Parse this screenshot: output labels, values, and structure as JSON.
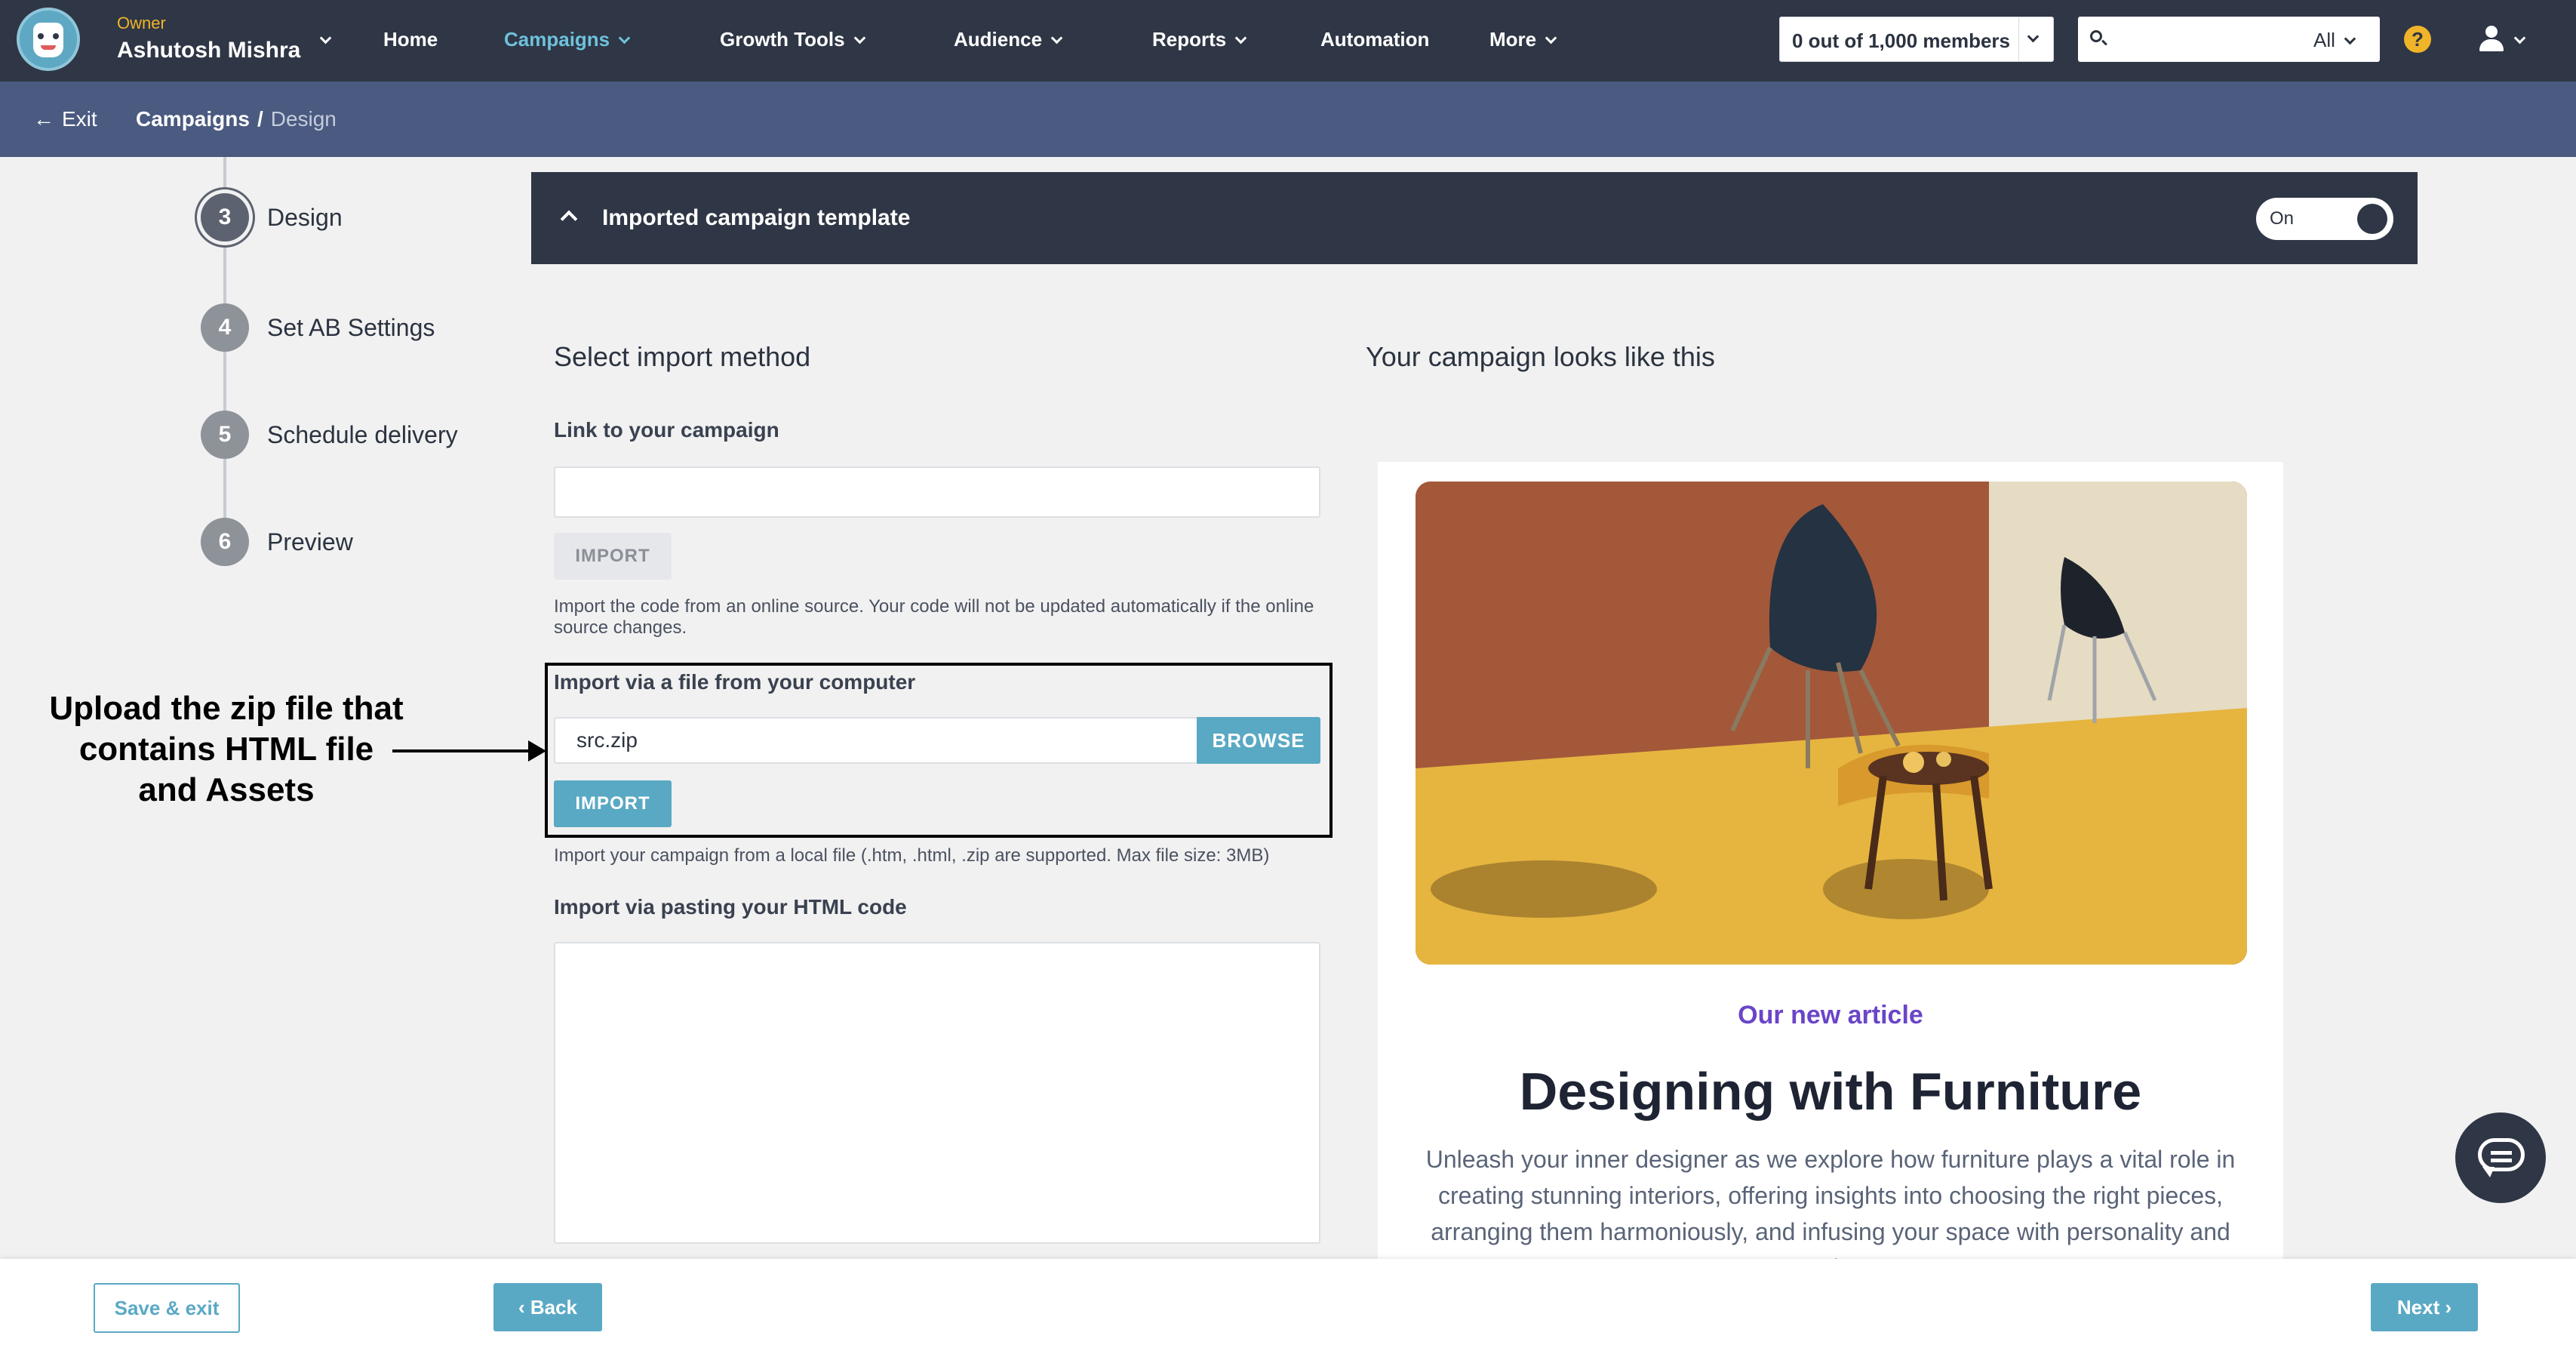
{
  "topnav": {
    "owner_role": "Owner",
    "owner_name": "Ashutosh Mishra",
    "items": [
      {
        "label": "Home",
        "active": false,
        "dropdown": false
      },
      {
        "label": "Campaigns",
        "active": true,
        "dropdown": true
      },
      {
        "label": "Growth Tools",
        "active": false,
        "dropdown": true
      },
      {
        "label": "Audience",
        "active": false,
        "dropdown": true
      },
      {
        "label": "Reports",
        "active": false,
        "dropdown": true
      },
      {
        "label": "Automation",
        "active": false,
        "dropdown": false
      },
      {
        "label": "More",
        "active": false,
        "dropdown": true
      }
    ],
    "members_label": "0 out of 1,000 members",
    "search_placeholder": "",
    "search_scope": "All",
    "help_label": "?",
    "icons": {
      "search": "search-icon",
      "help": "help-icon",
      "user": "user-icon"
    },
    "accent_color": "#6ec1dc"
  },
  "subnav": {
    "exit_label": "Exit",
    "breadcrumb": [
      "Campaigns",
      "Design"
    ],
    "separator": "/"
  },
  "steps": [
    {
      "number": "3",
      "label": "Design",
      "current": true
    },
    {
      "number": "4",
      "label": "Set AB Settings",
      "current": false
    },
    {
      "number": "5",
      "label": "Schedule delivery",
      "current": false
    },
    {
      "number": "6",
      "label": "Preview",
      "current": false
    }
  ],
  "annotation": {
    "text_lines": [
      "Upload the zip file that",
      "contains HTML file",
      "and Assets"
    ]
  },
  "template_bar": {
    "title": "Imported campaign template",
    "toggle_label": "On",
    "toggle_on": true
  },
  "import": {
    "section_title": "Select import method",
    "link": {
      "label": "Link to your campaign",
      "value": "",
      "button": "IMPORT",
      "help": "Import the code from an online source. Your code will not be updated automatically if the online source changes."
    },
    "file": {
      "label": "Import via a file from your computer",
      "value": "src.zip",
      "browse_button": "BROWSE",
      "button": "IMPORT",
      "help": "Import your campaign from a local file (.htm, .html, .zip are supported. Max file size: 3MB)"
    },
    "paste": {
      "label": "Import via pasting your HTML code",
      "value": ""
    }
  },
  "preview": {
    "section_title": "Your campaign looks like this",
    "kicker": "Our new article",
    "title": "Designing with Furniture",
    "body": "Unleash your inner designer as we explore how furniture plays a vital role in creating stunning interiors, offering insights into choosing the right pieces, arranging them harmoniously, and infusing your space with personality and style."
  },
  "footer": {
    "save_exit": "Save & exit",
    "back": "‹ Back",
    "next": "Next ›",
    "button_color": "#5aa9c4"
  }
}
